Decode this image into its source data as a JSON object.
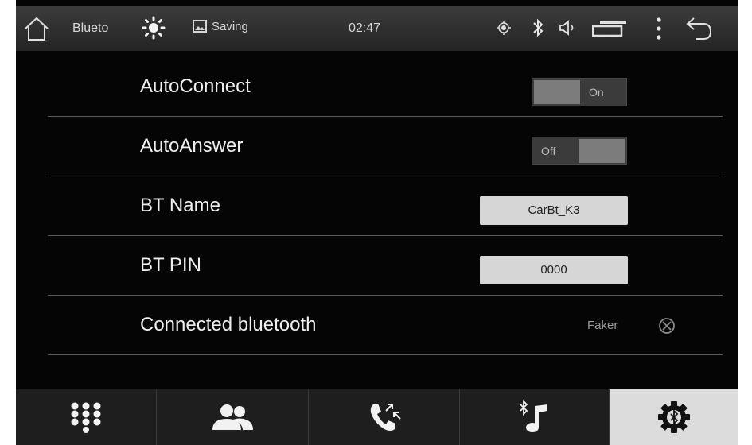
{
  "statusbar": {
    "app_title": "Blueto",
    "saving_label": "Saving",
    "clock": "02:47",
    "icons": [
      "home-icon",
      "brightness-icon",
      "image-icon",
      "gps-icon",
      "bluetooth-icon",
      "volume-icon",
      "battery-icon",
      "more-icon",
      "back-icon"
    ]
  },
  "settings": {
    "autoconnect": {
      "label": "AutoConnect",
      "state": "On"
    },
    "autoanswer": {
      "label": "AutoAnswer",
      "state": "Off"
    },
    "bt_name": {
      "label": "BT Name",
      "value": "CarBt_K3"
    },
    "bt_pin": {
      "label": "BT PIN",
      "value": "0000"
    },
    "connected": {
      "label": "Connected bluetooth",
      "device": "Faker"
    }
  },
  "bottom_nav": {
    "items": [
      "dialpad-icon",
      "contacts-icon",
      "call-log-icon",
      "bluetooth-music-icon",
      "bluetooth-settings-icon"
    ],
    "active": "bluetooth-settings-icon"
  },
  "colors": {
    "background": "#050505",
    "active_tab": "#dcdcdc",
    "field": "#d6d6d6"
  }
}
